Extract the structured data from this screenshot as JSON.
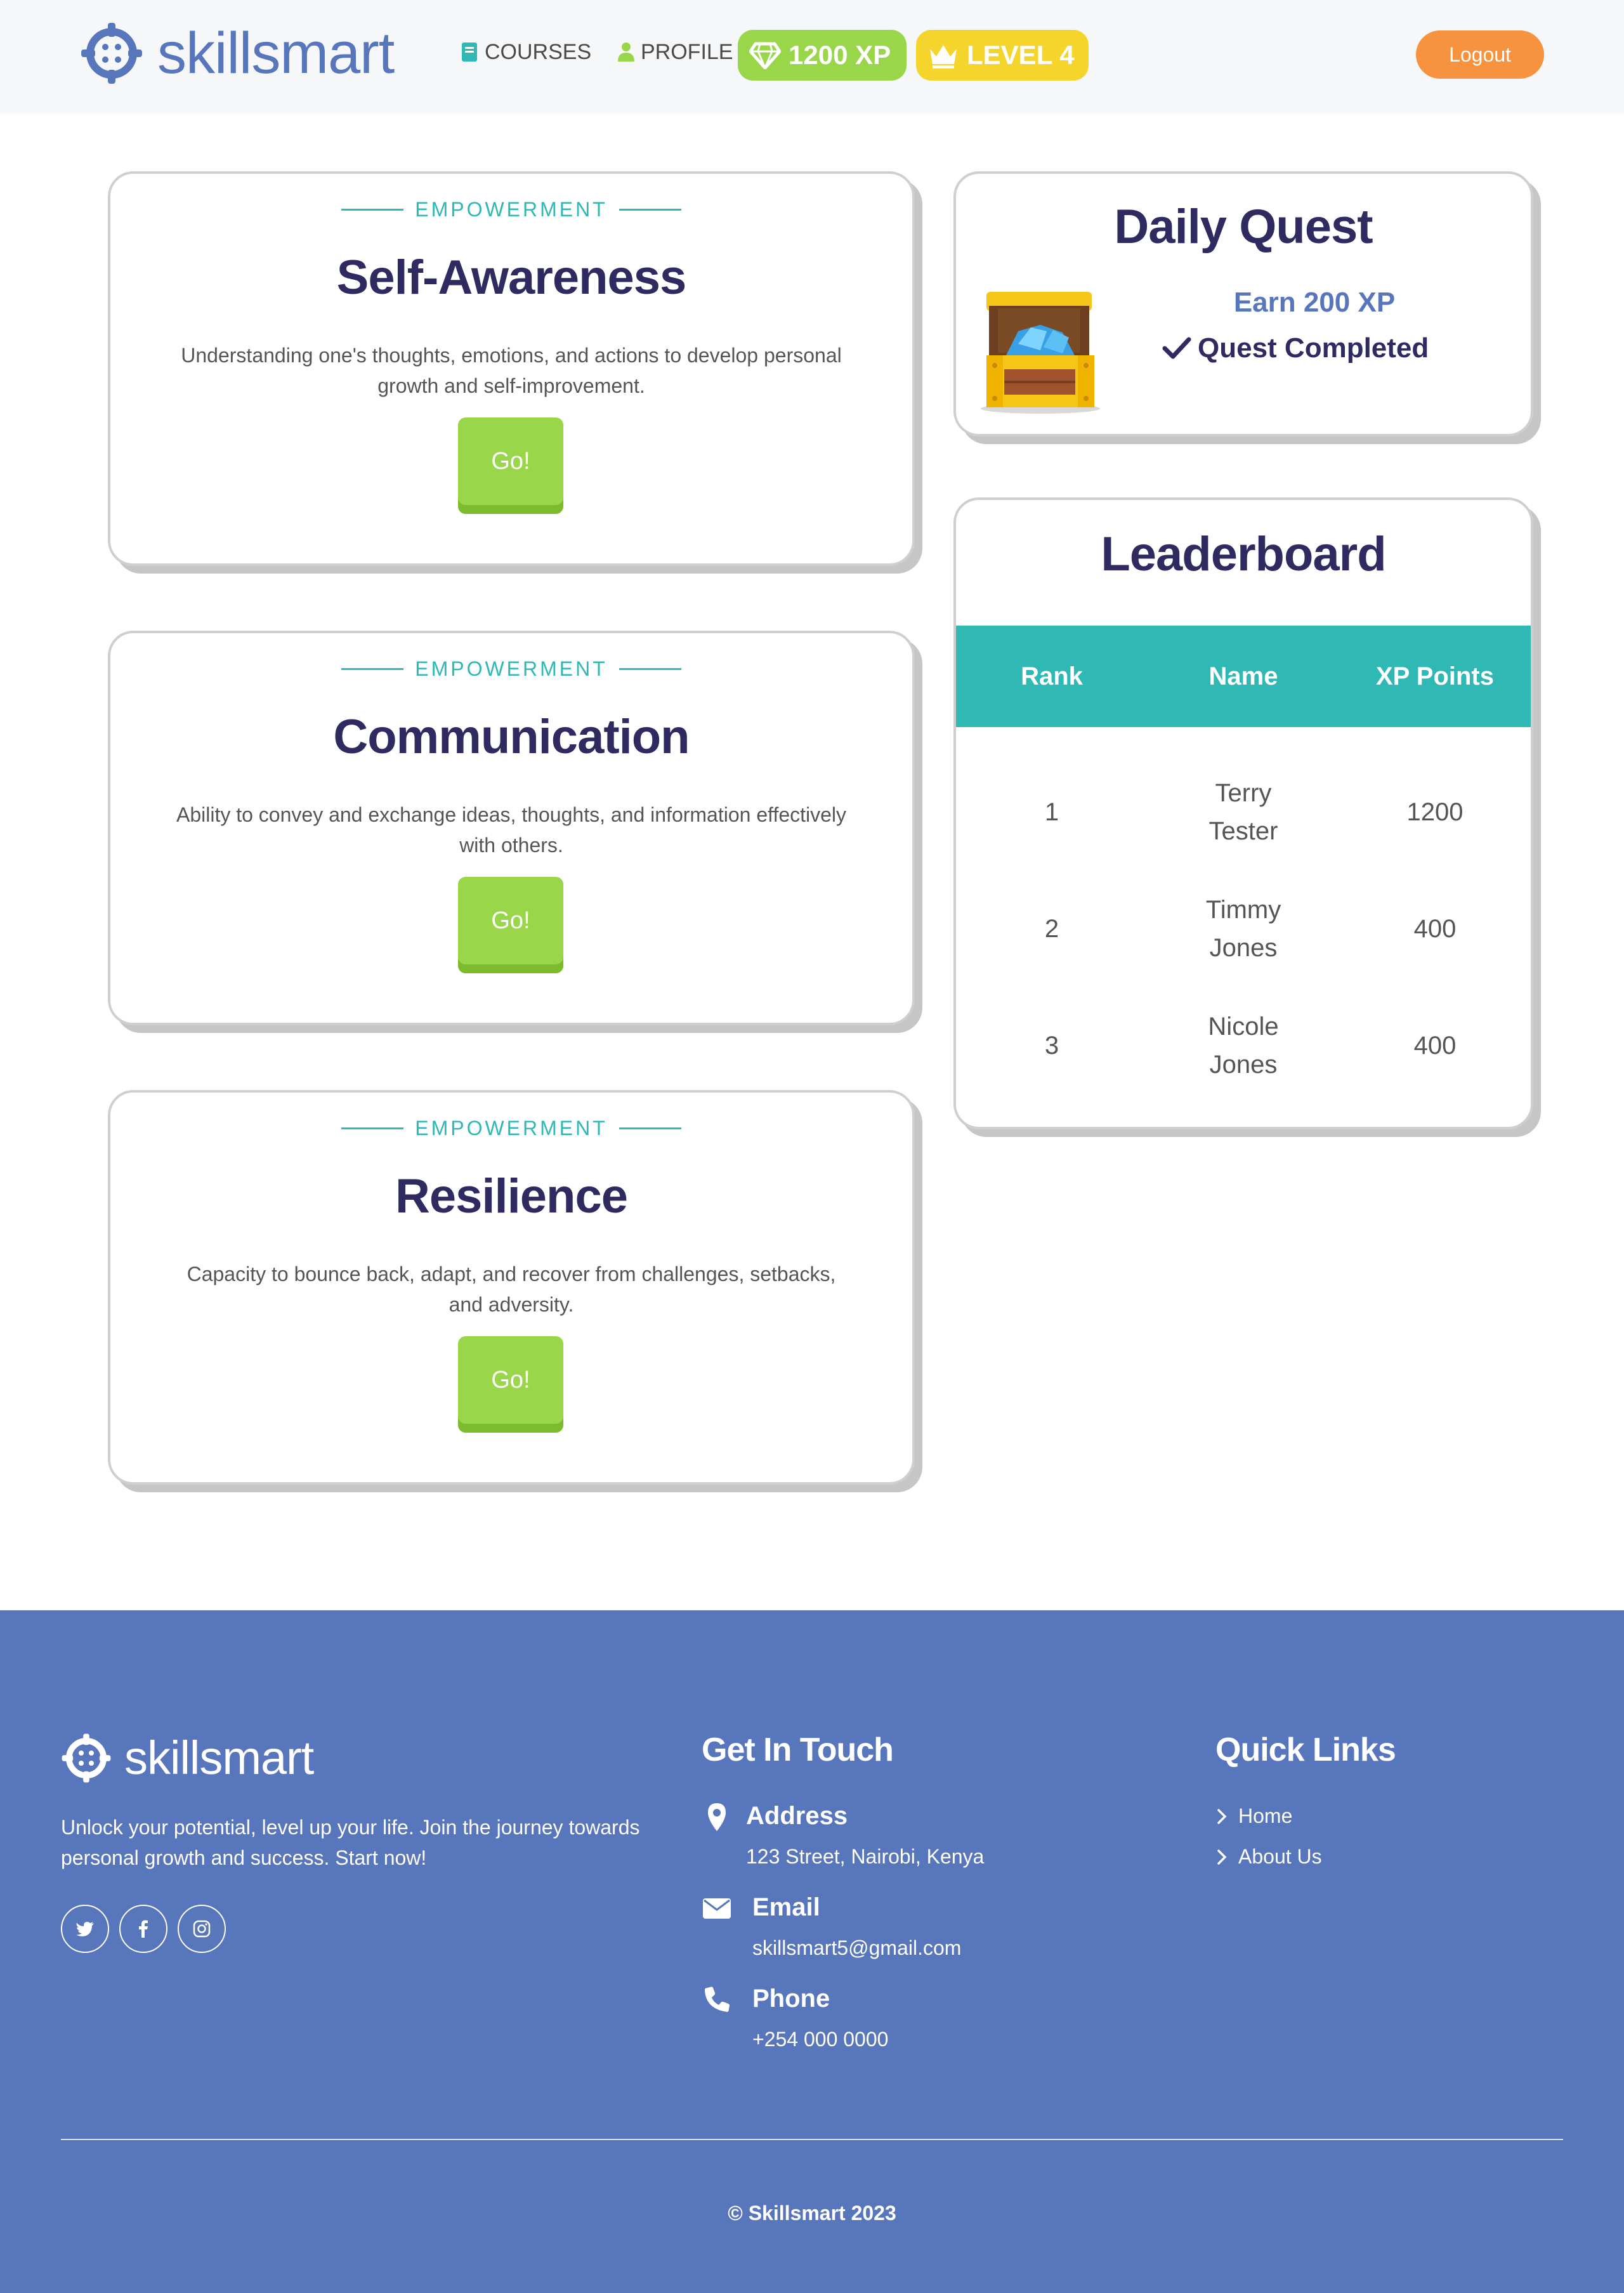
{
  "header": {
    "brand": "skillsmart",
    "nav": {
      "courses": "COURSES",
      "profile": "PROFILE"
    },
    "xp_badge": "1200 XP",
    "level_badge": "LEVEL 4",
    "logout": "Logout"
  },
  "colors": {
    "brand_blue": "#5876bb",
    "teal": "#2fb8b4",
    "green": "#9ad64a",
    "yellow": "#f5d52c",
    "orange": "#f7923f",
    "navy": "#2f2a5f"
  },
  "courses": [
    {
      "tag": "EMPOWERMENT",
      "title": "Self-Awareness",
      "description": "Understanding one's thoughts, emotions, and actions to develop personal growth and self-improvement.",
      "button": "Go!"
    },
    {
      "tag": "EMPOWERMENT",
      "title": "Communication",
      "description": "Ability to convey and exchange ideas, thoughts, and information effectively with others.",
      "button": "Go!"
    },
    {
      "tag": "EMPOWERMENT",
      "title": "Resilience",
      "description": "Capacity to bounce back, adapt, and recover from challenges, setbacks, and adversity.",
      "button": "Go!"
    }
  ],
  "daily_quest": {
    "title": "Daily Quest",
    "goal": "Earn 200 XP",
    "status": "Quest Completed",
    "icon": "treasure-chest-icon"
  },
  "leaderboard": {
    "title": "Leaderboard",
    "columns": [
      "Rank",
      "Name",
      "XP Points"
    ],
    "rows": [
      {
        "rank": "1",
        "name": "Terry Tester",
        "xp": "1200"
      },
      {
        "rank": "2",
        "name": "Timmy Jones",
        "xp": "400"
      },
      {
        "rank": "3",
        "name": "Nicole Jones",
        "xp": "400"
      }
    ]
  },
  "footer": {
    "brand": "skillsmart",
    "tagline": "Unlock your potential, level up your life. Join the journey towards personal growth and success. Start now!",
    "socials": [
      "twitter-icon",
      "facebook-icon",
      "instagram-icon"
    ],
    "contact_heading": "Get In Touch",
    "contact": {
      "address_label": "Address",
      "address": "123 Street, Nairobi, Kenya",
      "email_label": "Email",
      "email": "skillsmart5@gmail.com",
      "phone_label": "Phone",
      "phone": "+254 000 0000"
    },
    "links_heading": "Quick Links",
    "links": [
      "Home",
      "About Us"
    ],
    "copyright": "© Skillsmart 2023"
  }
}
